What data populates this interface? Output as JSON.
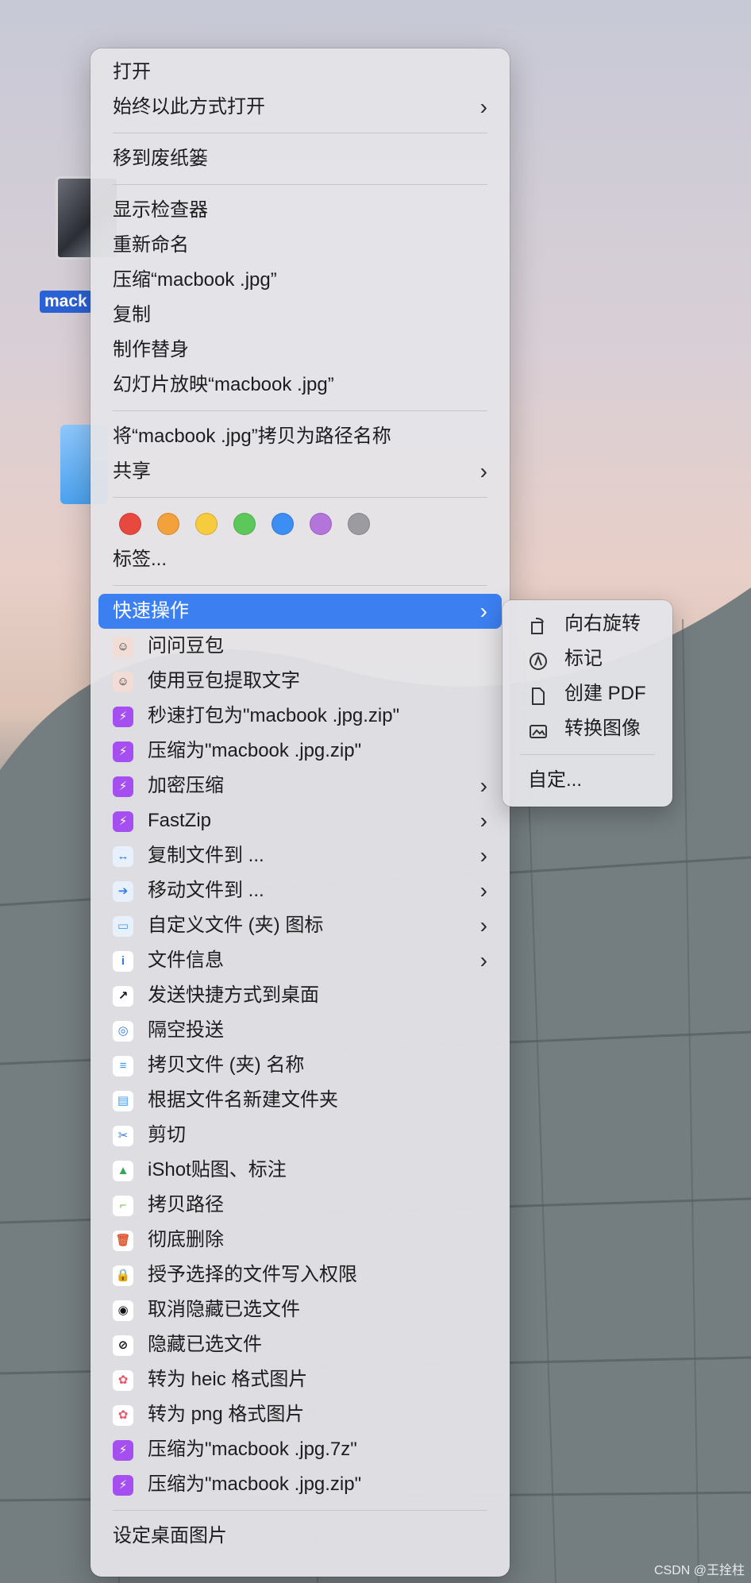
{
  "desktop": {
    "file_label": "mack",
    "watermark": "CSDN @王拴柱"
  },
  "menu": {
    "group1": [
      {
        "label": "打开"
      },
      {
        "label": "始终以此方式打开",
        "submenu": true
      }
    ],
    "group2": [
      {
        "label": "移到废纸篓"
      }
    ],
    "group3": [
      {
        "label": "显示检查器"
      },
      {
        "label": "重新命名"
      },
      {
        "label": "压缩“macbook .jpg”"
      },
      {
        "label": "复制"
      },
      {
        "label": "制作替身"
      },
      {
        "label": "幻灯片放映“macbook .jpg”"
      }
    ],
    "group4": [
      {
        "label": "将“macbook .jpg”拷贝为路径名称"
      },
      {
        "label": "共享",
        "submenu": true
      }
    ],
    "tag_colors": [
      "#e8493f",
      "#f3a13b",
      "#f6cb3e",
      "#5cc85b",
      "#3c8ef3",
      "#b374db",
      "#9b9ba0"
    ],
    "tags_label": "标签...",
    "quick_actions": {
      "label": "快速操作",
      "submenu": true
    },
    "services": [
      {
        "label": "问问豆包",
        "icon": "doubao-avatar-icon",
        "color": "#f2dcd6"
      },
      {
        "label": "使用豆包提取文字",
        "icon": "doubao-avatar-icon",
        "color": "#f2dcd6"
      },
      {
        "label": "秒速打包为\"macbook .jpg.zip\"",
        "icon": "shortcuts-icon",
        "color": "#a54ff0"
      },
      {
        "label": "压缩为\"macbook .jpg.zip\"",
        "icon": "shortcuts-icon",
        "color": "#a54ff0"
      },
      {
        "label": "加密压缩",
        "icon": "shortcuts-icon",
        "color": "#a54ff0",
        "submenu": true
      },
      {
        "label": "FastZip",
        "icon": "shortcuts-icon",
        "color": "#a54ff0",
        "submenu": true
      },
      {
        "label": "复制文件到 ...",
        "icon": "copy-arrows-icon",
        "color": "#e8f0fc",
        "submenu": true
      },
      {
        "label": "移动文件到 ...",
        "icon": "move-arrow-icon",
        "color": "#e8f0fc",
        "submenu": true
      },
      {
        "label": "自定义文件 (夹) 图标",
        "icon": "folder-icon",
        "color": "#e8f0fc",
        "submenu": true
      },
      {
        "label": "文件信息",
        "icon": "info-icon",
        "color": "#ffffff",
        "submenu": true
      },
      {
        "label": "发送快捷方式到桌面",
        "icon": "alias-arrow-icon",
        "color": "#ffffff"
      },
      {
        "label": "隔空投送",
        "icon": "airdrop-icon",
        "color": "#ffffff"
      },
      {
        "label": "拷贝文件 (夹) 名称",
        "icon": "copy-name-icon",
        "color": "#ffffff"
      },
      {
        "label": "根据文件名新建文件夹",
        "icon": "new-folder-icon",
        "color": "#ffffff"
      },
      {
        "label": "剪切",
        "icon": "scissors-icon",
        "color": "#ffffff"
      },
      {
        "label": "iShot贴图、标注",
        "icon": "ishot-icon",
        "color": "#ffffff"
      },
      {
        "label": "拷贝路径",
        "icon": "path-icon",
        "color": "#ffffff"
      },
      {
        "label": "彻底删除",
        "icon": "trash-icon",
        "color": "#ffffff"
      },
      {
        "label": "授予选择的文件写入权限",
        "icon": "lock-icon",
        "color": "#ffffff"
      },
      {
        "label": "取消隐藏已选文件",
        "icon": "eye-icon",
        "color": "#ffffff"
      },
      {
        "label": "隐藏已选文件",
        "icon": "eye-hidden-icon",
        "color": "#ffffff"
      },
      {
        "label": "转为 heic 格式图片",
        "icon": "photos-icon",
        "color": "#ffffff"
      },
      {
        "label": "转为 png 格式图片",
        "icon": "photos-icon",
        "color": "#ffffff"
      },
      {
        "label": "压缩为\"macbook .jpg.7z\"",
        "icon": "shortcuts-icon",
        "color": "#a54ff0"
      },
      {
        "label": "压缩为\"macbook .jpg.zip\"",
        "icon": "shortcuts-icon",
        "color": "#a54ff0"
      }
    ],
    "footer": {
      "label": "设定桌面图片"
    }
  },
  "submenu": {
    "items": [
      {
        "label": "向右旋转",
        "icon": "rotate-right-icon"
      },
      {
        "label": "标记",
        "icon": "markup-icon"
      },
      {
        "label": "创建 PDF",
        "icon": "pdf-icon"
      },
      {
        "label": "转换图像",
        "icon": "convert-image-icon"
      }
    ],
    "customize": "自定..."
  }
}
